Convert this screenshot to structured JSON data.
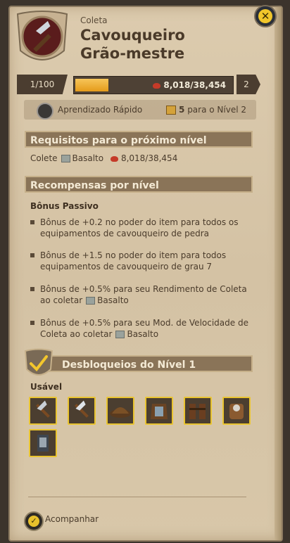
{
  "header": {
    "category": "Coleta",
    "title_line1": "Cavouqueiro",
    "title_line2": "Grão-mestre",
    "close_icon": "close-x-icon"
  },
  "level": {
    "tier": "1/100",
    "fame": "8,018/38,454",
    "progress_fraction": 0.21,
    "next_tier": "2"
  },
  "perk": {
    "name": "Aprendizado Rápido",
    "points": "5",
    "points_text": "para o Nível 2"
  },
  "requirements": {
    "heading": "Requisitos para o próximo nível",
    "action": "Colete",
    "resource": "Basalto",
    "fame": "8,018/38,454"
  },
  "rewards": {
    "heading": "Recompensas por nível",
    "passive_title": "Bônus Passivo",
    "bullets": [
      "Bônus de +0.2 no poder do item para todos os equipamentos de cavouqueiro de pedra",
      "Bônus de +1.5 no poder do item para todos equipamentos de cavouqueiro de grau 7",
      "Bônus de +0.5% para seu Rendimento de Coleta ao coletar",
      "Bônus de +0.5% para seu Mod. de Velocidade de Coleta ao coletar"
    ],
    "bullet_resource": "Basalto"
  },
  "unlocks": {
    "heading": "Desbloqueios do Nível 1",
    "usable_label": "Usável",
    "items": [
      "pickaxe-icon",
      "pickaxe-icon",
      "cap-icon",
      "armor-icon",
      "boots-icon",
      "backpack-icon",
      "tool-icon"
    ]
  },
  "footer": {
    "follow_label": "Acompanhar"
  },
  "colors": {
    "accent": "#e9c430",
    "progress": "#f0ae2e",
    "panel": "#d9c8ab"
  }
}
